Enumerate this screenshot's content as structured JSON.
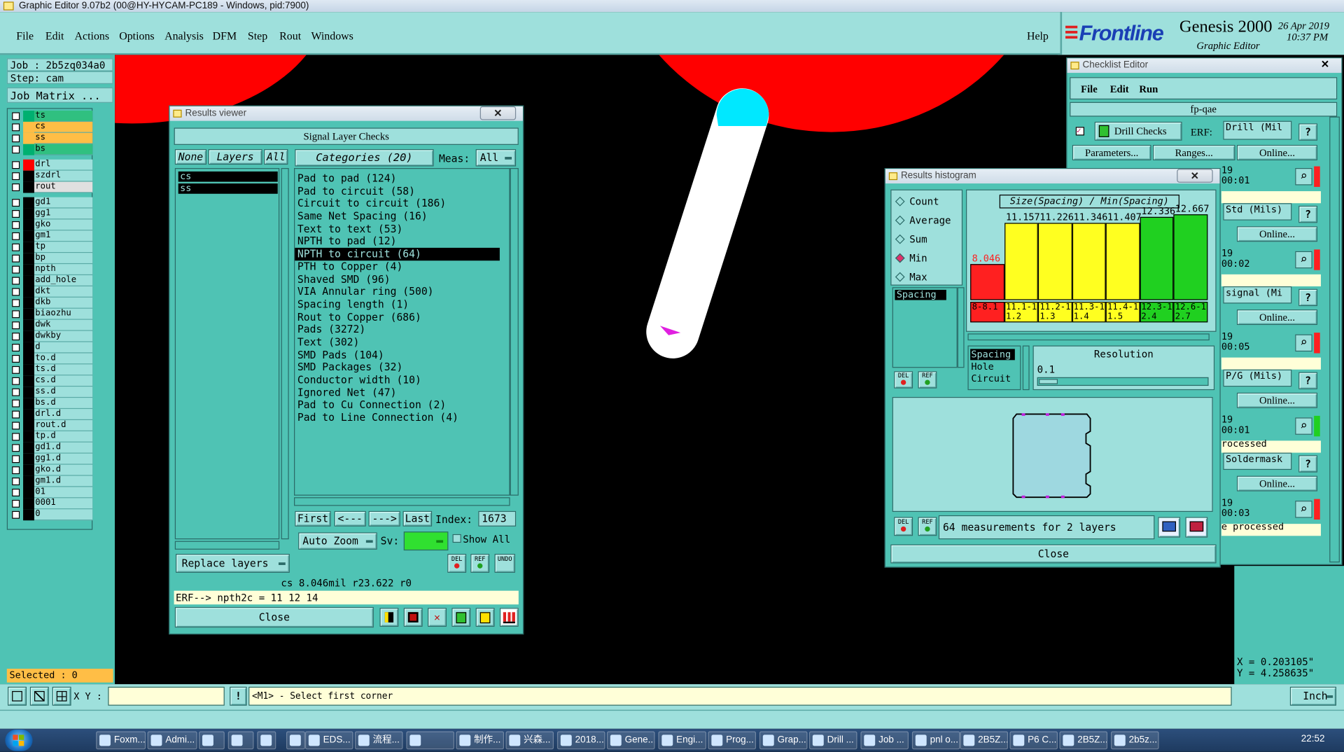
{
  "app_title": "Graphic Editor 9.07b2 (00@HY-HYCAM-PC189 - Windows, pid:7900)",
  "menu": [
    "File",
    "Edit",
    "Actions",
    "Options",
    "Analysis",
    "DFM",
    "Step",
    "Rout",
    "Windows"
  ],
  "help": "Help",
  "brand": {
    "logo": "Frontline",
    "product": "Genesis 2000",
    "subtitle": "Graphic Editor",
    "date": "26 Apr 2019",
    "time": "10:37 PM"
  },
  "job": {
    "job": "Job : 2b5zq034a0",
    "step": "Step: cam",
    "matrix": "Job Matrix ..."
  },
  "layers": [
    {
      "name": "ts",
      "color": "#00b070",
      "bg": "#30c080"
    },
    {
      "name": "cs",
      "color": "#ffbe46",
      "bg": "#ffbe46"
    },
    {
      "name": "ss",
      "color": "#ffbe46",
      "bg": "#ffbe46"
    },
    {
      "name": "bs",
      "color": "#00b070",
      "bg": "#30c080"
    },
    {
      "name": "drl",
      "color": "#ff0000",
      "bg": "#9ee0dc"
    },
    {
      "name": "szdrl",
      "color": "#000",
      "bg": "#9ee0dc"
    },
    {
      "name": "rout",
      "color": "#000",
      "bg": "#e0e0e0"
    },
    {
      "name": "gd1"
    },
    {
      "name": "gg1"
    },
    {
      "name": "gko"
    },
    {
      "name": "gm1"
    },
    {
      "name": "tp"
    },
    {
      "name": "bp"
    },
    {
      "name": "npth"
    },
    {
      "name": "add_hole"
    },
    {
      "name": "dkt"
    },
    {
      "name": "dkb"
    },
    {
      "name": "biaozhu"
    },
    {
      "name": "dwk"
    },
    {
      "name": "dwkby"
    },
    {
      "name": "d"
    },
    {
      "name": "to.d"
    },
    {
      "name": "ts.d"
    },
    {
      "name": "cs.d"
    },
    {
      "name": "ss.d"
    },
    {
      "name": "bs.d"
    },
    {
      "name": "drl.d"
    },
    {
      "name": "rout.d"
    },
    {
      "name": "tp.d"
    },
    {
      "name": "gd1.d"
    },
    {
      "name": "gg1.d"
    },
    {
      "name": "gko.d"
    },
    {
      "name": "gm1.d"
    },
    {
      "name": "01"
    },
    {
      "name": "0001"
    },
    {
      "name": "0"
    }
  ],
  "selected": "Selected : 0",
  "results_viewer": {
    "title": "Results viewer",
    "header": "Signal Layer Checks",
    "none": "None",
    "layers_label": "Layers",
    "all": "All",
    "categories": "Categories (20)",
    "meas_label": "Meas:",
    "meas_value": "All",
    "layer_items": [
      "cs",
      "ss"
    ],
    "category_items": [
      "Pad to pad (124)",
      "Pad to circuit (58)",
      "Circuit to circuit (186)",
      "Same Net Spacing (16)",
      "Text to text (53)",
      "NPTH to pad (12)",
      "NPTH to circuit (64)",
      "PTH to Copper (4)",
      "Shaved SMD (96)",
      "VIA Annular ring (500)",
      "Spacing length (1)",
      "Rout to Copper (686)",
      "Pads (3272)",
      "Text (302)",
      "SMD Pads (104)",
      "SMD Packages (32)",
      "Conductor width (10)",
      "Ignored Net (47)",
      "Pad to Cu Connection (2)",
      "Pad to Line Connection (4)"
    ],
    "selected_category": "NPTH to circuit (64)",
    "first": "First",
    "prev": "<---",
    "next": "--->",
    "last": "Last",
    "index_label": "Index:",
    "index_value": "1673",
    "auto_zoom": "Auto Zoom",
    "sv": "Sv:",
    "show_all": "Show All",
    "replace_layers": "Replace layers",
    "status": "cs 8.046mil  r23.622  r0",
    "erf": "ERF--> npth2c = 11 12 14",
    "close": "Close",
    "del": "DEL",
    "ref": "REF",
    "undo": "UNDO"
  },
  "histogram": {
    "title": "Results histogram",
    "stats": [
      "Count",
      "Average",
      "Sum",
      "Min",
      "Max"
    ],
    "selected_stat": "Min",
    "list_top": [
      "Spacing"
    ],
    "chart_title": "Size(Spacing) / Min(Spacing)",
    "bars": [
      {
        "value": "8.046",
        "range": "8-8.1",
        "h": 0.42,
        "color": "#ff2020",
        "text": "#ff2020"
      },
      {
        "value": "11.157",
        "range": "11.1-11.2",
        "h": 0.9,
        "color": "#ffff20",
        "text": "#000"
      },
      {
        "value": "11.226",
        "range": "11.2-11.3",
        "h": 0.9,
        "color": "#ffff20",
        "text": "#000"
      },
      {
        "value": "11.346",
        "range": "11.3-11.4",
        "h": 0.9,
        "color": "#ffff20",
        "text": "#000"
      },
      {
        "value": "11.407",
        "range": "11.4-11.5",
        "h": 0.9,
        "color": "#ffff20",
        "text": "#000"
      },
      {
        "value": "12.336",
        "range": "12.3-12.4",
        "h": 0.97,
        "color": "#20d020",
        "text": "#000"
      },
      {
        "value": "12.667",
        "range": "12.6-12.7",
        "h": 1.0,
        "color": "#20d020",
        "text": "#000"
      }
    ],
    "type_list": [
      "Spacing",
      "Hole",
      "Circuit"
    ],
    "resolution_label": "Resolution",
    "resolution_value": "0.1",
    "measurements": "64 measurements for 2 layers",
    "close": "Close",
    "del": "DEL",
    "ref": "REF"
  },
  "checklist": {
    "title": "Checklist Editor",
    "menu": [
      "File",
      "Edit",
      "Run"
    ],
    "name": "fp-qae",
    "drill_checks": "Drill Checks",
    "erf": "ERF:",
    "erf_value": "Drill (Mil",
    "parameters": "Parameters...",
    "ranges": "Ranges...",
    "online": "Online...",
    "rows": [
      {
        "date": "19",
        "time": "00:01",
        "mark": "#ff2020",
        "label": "Std (Mils)"
      },
      {
        "date": "19",
        "time": "00:02",
        "mark": "#ff2020",
        "label": "signal (Mi"
      },
      {
        "date": "19",
        "time": "00:05",
        "mark": "#ff2020",
        "label": "P/G (Mils)"
      },
      {
        "date": "19",
        "time": "00:01",
        "mark": "#20d020",
        "label": "Soldermask"
      },
      {
        "date": "19",
        "time": "00:03",
        "mark": "#ff2020",
        "label": ""
      }
    ],
    "processed1": "rocessed",
    "processed2": "e processed",
    "q": "?"
  },
  "coords": {
    "x": "X = 0.203105\"",
    "y": "Y = 4.258635\""
  },
  "bottom": {
    "xy_label": "X Y :",
    "xy_value": "",
    "prompt": "<M1> - Select first corner",
    "units": "Inch"
  },
  "taskbar": {
    "items": [
      "Foxm...",
      "Admi...",
      "",
      "",
      "",
      "",
      "EDS...",
      "流程...",
      "",
      "制作...",
      "兴森...",
      "2018...",
      "Gene...",
      "Engi...",
      "Prog...",
      "Grap...",
      "Drill ...",
      "Job ...",
      "pnl o...",
      "2B5Z...",
      "P6 C...",
      "2B5Z...",
      "2b5z..."
    ],
    "clock": "22:52"
  }
}
